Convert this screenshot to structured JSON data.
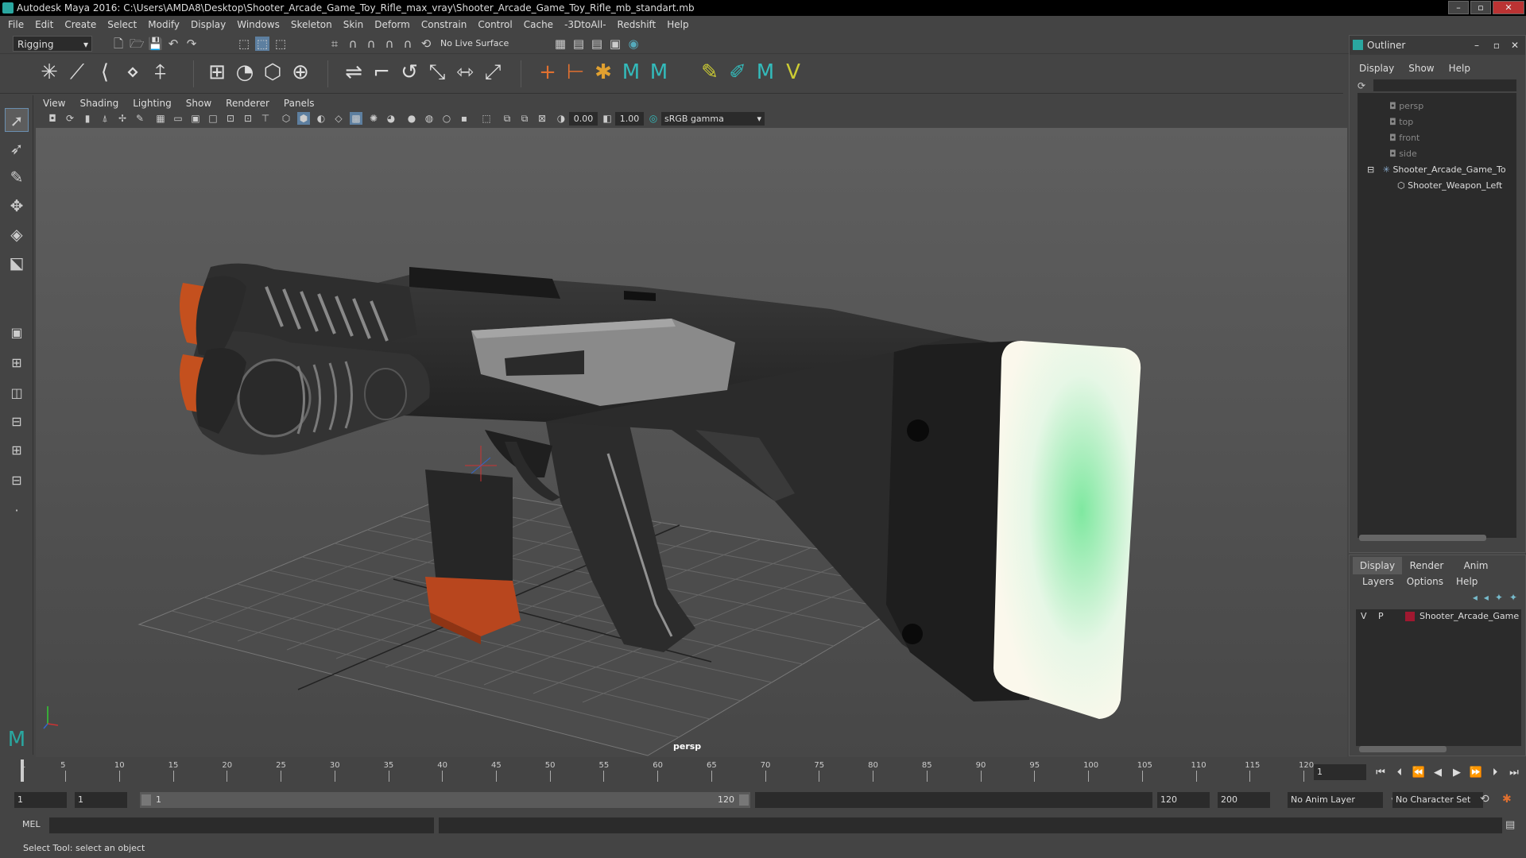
{
  "title_bar": {
    "text": "Autodesk Maya 2016: C:\\Users\\AMDA8\\Desktop\\Shooter_Arcade_Game_Toy_Rifle_max_vray\\Shooter_Arcade_Game_Toy_Rifle_mb_standart.mb"
  },
  "main_menu": [
    "File",
    "Edit",
    "Create",
    "Select",
    "Modify",
    "Display",
    "Windows",
    "Skeleton",
    "Skin",
    "Deform",
    "Constrain",
    "Control",
    "Cache",
    "-3DtoAll-",
    "Redshift",
    "Help"
  ],
  "status_line": {
    "mode": "Rigging",
    "live_surface": "No Live Surface"
  },
  "panel_menu": [
    "View",
    "Shading",
    "Lighting",
    "Show",
    "Renderer",
    "Panels"
  ],
  "panel_toolbar": {
    "exposure": "0.00",
    "gamma": "1.00",
    "color_space": "sRGB gamma"
  },
  "viewport": {
    "camera_label": "persp"
  },
  "outliner": {
    "title": "Outliner",
    "menu": [
      "Display",
      "Show",
      "Help"
    ],
    "items": [
      {
        "label": "persp",
        "dim": true
      },
      {
        "label": "top",
        "dim": true
      },
      {
        "label": "front",
        "dim": true
      },
      {
        "label": "side",
        "dim": true
      },
      {
        "label": "Shooter_Arcade_Game_To",
        "dim": false
      },
      {
        "label": "Shooter_Weapon_Left",
        "dim": false
      }
    ]
  },
  "layer_editor": {
    "tabs": [
      "Display",
      "Render",
      "Anim"
    ],
    "menu": [
      "Layers",
      "Options",
      "Help"
    ],
    "layer": {
      "v": "V",
      "p": "P",
      "name": "Shooter_Arcade_Game",
      "color": "#a01830"
    }
  },
  "time_slider": {
    "ticks": [
      "1",
      "5",
      "10",
      "15",
      "20",
      "25",
      "30",
      "35",
      "40",
      "45",
      "50",
      "55",
      "60",
      "65",
      "70",
      "75",
      "80",
      "85",
      "90",
      "95",
      "100",
      "105",
      "110",
      "115",
      "120"
    ],
    "current_frame": "1"
  },
  "range_slider": {
    "start": "1",
    "anim_start": "1",
    "range_start": "1",
    "range_end": "120",
    "playback_end": "120",
    "anim_end": "200",
    "anim_layer": "No Anim Layer",
    "character_set": "No Character Set"
  },
  "command_line": {
    "label": "MEL"
  },
  "help_line": {
    "text": "Select Tool: select an object"
  }
}
